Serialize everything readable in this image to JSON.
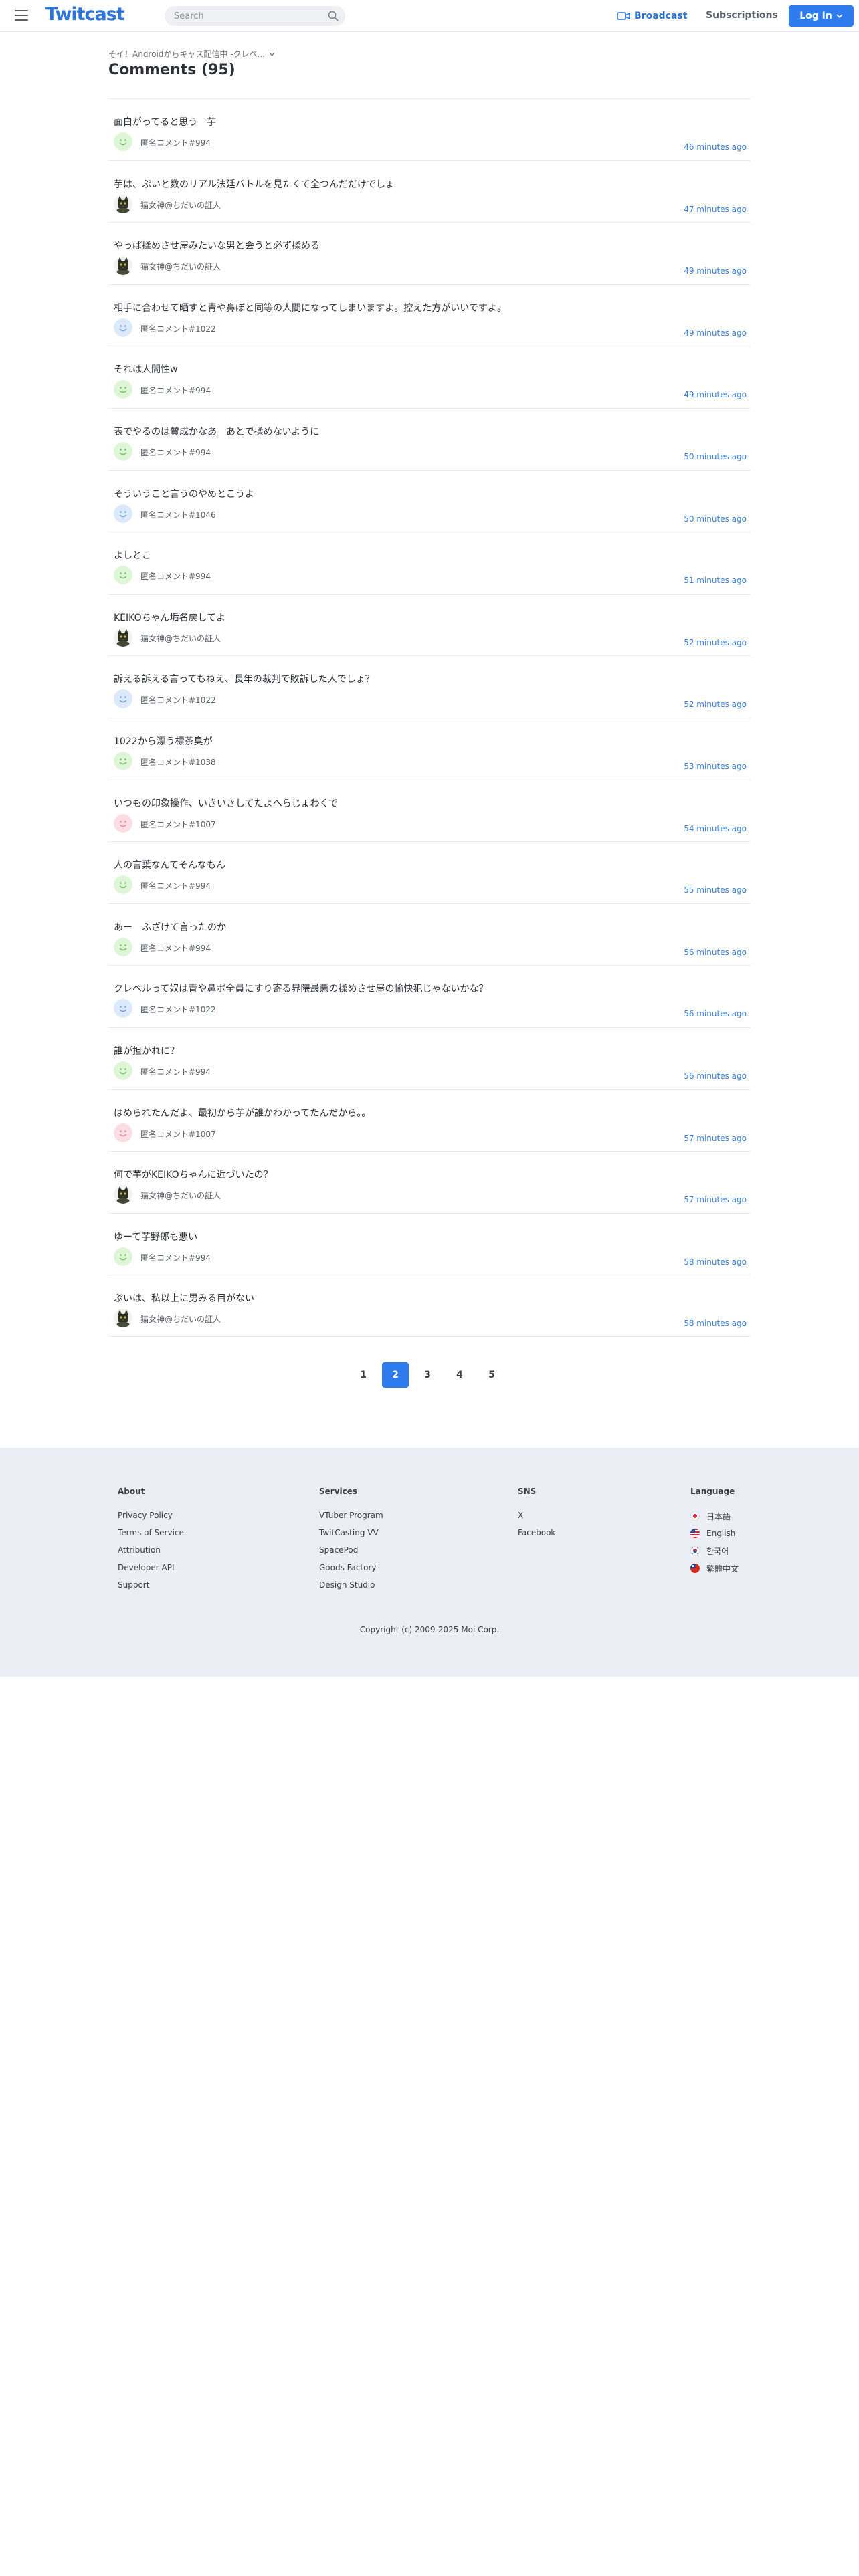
{
  "header": {
    "logo": "Twitcast",
    "search_placeholder": "Search",
    "broadcast_label": "Broadcast",
    "subscriptions_label": "Subscriptions",
    "login_label": "Log In",
    "accent": "#2e7bee"
  },
  "page": {
    "subtitle": "そイ！Androidからキャス配信中 -クレベ...",
    "title": "Comments (95)"
  },
  "comments": [
    {
      "text": "面白がってると思う　芋",
      "user": "匿名コメント#994",
      "time": "46 minutes ago",
      "avatar": "green-smile"
    },
    {
      "text": "芋は、ぷいと数のリアル法廷バトルを見たくて全つんだだけでしょ",
      "user": "猫女神@ちだいの証人",
      "time": "47 minutes ago",
      "avatar": "cat"
    },
    {
      "text": "やっぱ揉めさせ屋みたいな男と会うと必ず揉める",
      "user": "猫女神@ちだいの証人",
      "time": "49 minutes ago",
      "avatar": "cat"
    },
    {
      "text": "相手に合わせて晒すと青や鼻ぼと同等の人間になってしまいますよ。控えた方がいいですよ。",
      "user": "匿名コメント#1022",
      "time": "49 minutes ago",
      "avatar": "blue-smile"
    },
    {
      "text": "それは人間性w",
      "user": "匿名コメント#994",
      "time": "49 minutes ago",
      "avatar": "green-smile"
    },
    {
      "text": "表でやるのは賛成かなあ　あとで揉めないように",
      "user": "匿名コメント#994",
      "time": "50 minutes ago",
      "avatar": "green-smile"
    },
    {
      "text": "そういうこと言うのやめとこうよ",
      "user": "匿名コメント#1046",
      "time": "50 minutes ago",
      "avatar": "blue-smile"
    },
    {
      "text": "よしとこ",
      "user": "匿名コメント#994",
      "time": "51 minutes ago",
      "avatar": "green-smile"
    },
    {
      "text": "KEIKOちゃん垢名戻してよ",
      "user": "猫女神@ちだいの証人",
      "time": "52 minutes ago",
      "avatar": "cat"
    },
    {
      "text": "訴える訴える言ってもねえ、長年の裁判で敗訴した人でしょ？",
      "user": "匿名コメント#1022",
      "time": "52 minutes ago",
      "avatar": "blue-smile"
    },
    {
      "text": "1022から漂う標茶臭が",
      "user": "匿名コメント#1038",
      "time": "53 minutes ago",
      "avatar": "green-smile"
    },
    {
      "text": "いつもの印象操作、いきいきしてたよへらじょわくで",
      "user": "匿名コメント#1007",
      "time": "54 minutes ago",
      "avatar": "pink-smile"
    },
    {
      "text": "人の言葉なんてそんなもん",
      "user": "匿名コメント#994",
      "time": "55 minutes ago",
      "avatar": "green-smile"
    },
    {
      "text": "あー　ふざけて言ったのか",
      "user": "匿名コメント#994",
      "time": "56 minutes ago",
      "avatar": "green-smile"
    },
    {
      "text": "クレベルって奴は青や鼻ポ全員にすり寄る界隈最悪の揉めさせ屋の愉快犯じゃないかな？",
      "user": "匿名コメント#1022",
      "time": "56 minutes ago",
      "avatar": "blue-smile"
    },
    {
      "text": "誰が担かれに？",
      "user": "匿名コメント#994",
      "time": "56 minutes ago",
      "avatar": "green-smile"
    },
    {
      "text": "はめられたんだよ、最初から芋が誰かわかってたんだから。。",
      "user": "匿名コメント#1007",
      "time": "57 minutes ago",
      "avatar": "pink-smile"
    },
    {
      "text": "何で芋がKEIKOちゃんに近づいたの？",
      "user": "猫女神@ちだいの証人",
      "time": "57 minutes ago",
      "avatar": "cat"
    },
    {
      "text": "ゆーて芋野郎も悪い",
      "user": "匿名コメント#994",
      "time": "58 minutes ago",
      "avatar": "green-smile"
    },
    {
      "text": "ぷいは、私以上に男みる目がない",
      "user": "猫女神@ちだいの証人",
      "time": "58 minutes ago",
      "avatar": "cat"
    }
  ],
  "pagination": {
    "pages": [
      "1",
      "2",
      "3",
      "4",
      "5"
    ],
    "current": "2"
  },
  "footer": {
    "about": {
      "heading": "About",
      "links": [
        "Privacy Policy",
        "Terms of Service",
        "Attribution",
        "Developer API",
        "Support"
      ]
    },
    "services": {
      "heading": "Services",
      "links": [
        "VTuber Program",
        "TwitCasting VV",
        "SpacePod",
        "Goods Factory",
        "Design Studio"
      ]
    },
    "sns": {
      "heading": "SNS",
      "links": [
        "X",
        "Facebook"
      ]
    },
    "language": {
      "heading": "Language",
      "links": [
        "日本語",
        "English",
        "한국어",
        "繁體中文"
      ]
    },
    "copyright": "Copyright (c) 2009-2025 Moi Corp."
  }
}
